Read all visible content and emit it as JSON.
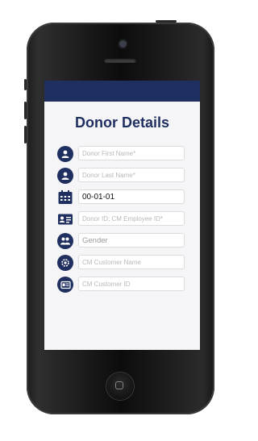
{
  "screen": {
    "title": "Donor Details",
    "fields": [
      {
        "icon": "person-icon",
        "placeholder": "Donor First Name*",
        "value": ""
      },
      {
        "icon": "person-icon",
        "placeholder": "Donor Last Name*",
        "value": ""
      },
      {
        "icon": "calendar-icon",
        "placeholder": "",
        "value": "00-01-01"
      },
      {
        "icon": "id-card-icon",
        "placeholder": "Donor ID; CM Employee ID*",
        "value": ""
      },
      {
        "icon": "group-icon",
        "placeholder": "Gender",
        "value": ""
      },
      {
        "icon": "gear-icon",
        "placeholder": "CM Customer Name",
        "value": ""
      },
      {
        "icon": "id-badge-icon",
        "placeholder": "CM Customer ID",
        "value": ""
      }
    ]
  },
  "colors": {
    "primary": "#1f2f60",
    "background": "#f5f5f7"
  }
}
